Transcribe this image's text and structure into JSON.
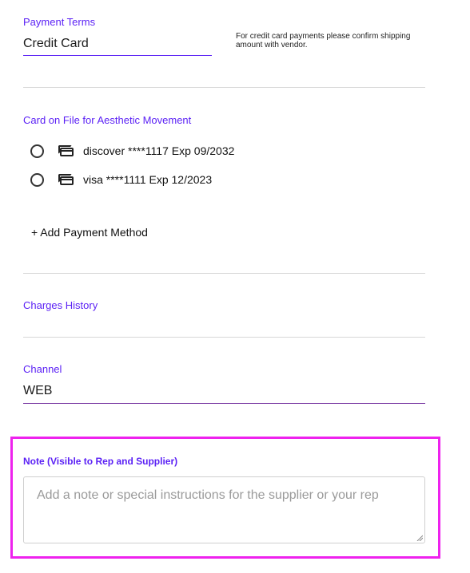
{
  "payment_terms": {
    "label": "Payment Terms",
    "value": "Credit Card",
    "note": "For credit card payments please confirm shipping amount with vendor."
  },
  "card_on_file": {
    "label": "Card on File for Aesthetic Movement",
    "cards": [
      {
        "text": "discover ****1117 Exp 09/2032",
        "icon": "credit-card-icon",
        "selected": false
      },
      {
        "text": "visa ****1111 Exp 12/2023",
        "icon": "credit-card-icon",
        "selected": false
      }
    ],
    "add_label": "+ Add Payment Method"
  },
  "charges_history": {
    "label": "Charges History"
  },
  "channel": {
    "label": "Channel",
    "value": "WEB"
  },
  "note": {
    "label": "Note (Visible to Rep and Supplier)",
    "placeholder": "Add a note or special instructions for the supplier or your rep",
    "value": ""
  },
  "colors": {
    "accent": "#5b21f5",
    "highlight": "#ee22ee",
    "divider": "#d6d6d6"
  }
}
